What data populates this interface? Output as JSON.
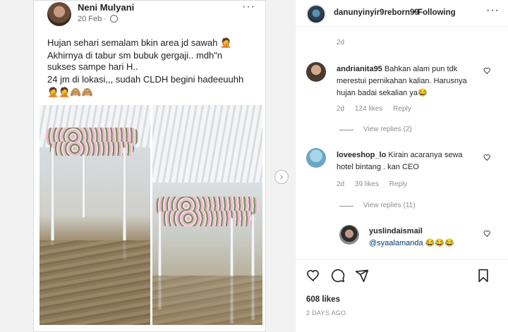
{
  "fb_post": {
    "author": "Neni Mulyani",
    "date": "20 Feb ·",
    "more": "···",
    "lines": [
      "Hujan sehari semalam bkin area jd sawah 🤦",
      "Akhirnya di tabur sm bubuk gergaji.. mdh\"n",
      "sukses sampe hari H..",
      "24 jm di lokasi,,, sudah CLDH begini hadeeuuhh",
      "🤦🤦🙈🙈"
    ]
  },
  "nav": {
    "next": "›"
  },
  "header": {
    "username": "danunyinyir9reborn99",
    "dot": "•",
    "following": "Following",
    "more": "···"
  },
  "caption_time": "2d",
  "comments": [
    {
      "user": "andrianita95",
      "text": "Bahkan alam pun tdk merestui pernikahan kalian. Harusnya hujan badai sekalian ya😂",
      "time": "2d",
      "likes": "124 likes",
      "reply": "Reply",
      "view_replies": "View replies (2)"
    },
    {
      "user": "loveeshop_lo",
      "text": "Kirain acaranya sewa hotel bintang . kan CEO",
      "time": "2d",
      "likes": "39 likes",
      "reply": "Reply",
      "view_replies": "View replies (11)"
    },
    {
      "user": "yuslindaismail",
      "mention": "@syaalamanda",
      "text": "😂😂😂"
    }
  ],
  "post": {
    "likes": "608 likes",
    "ago": "2 DAYS AGO"
  },
  "icons": {
    "heart": "heart-icon",
    "comment": "comment-icon",
    "share": "share-icon",
    "bookmark": "bookmark-icon",
    "comment_like": "heart-outline-icon"
  }
}
